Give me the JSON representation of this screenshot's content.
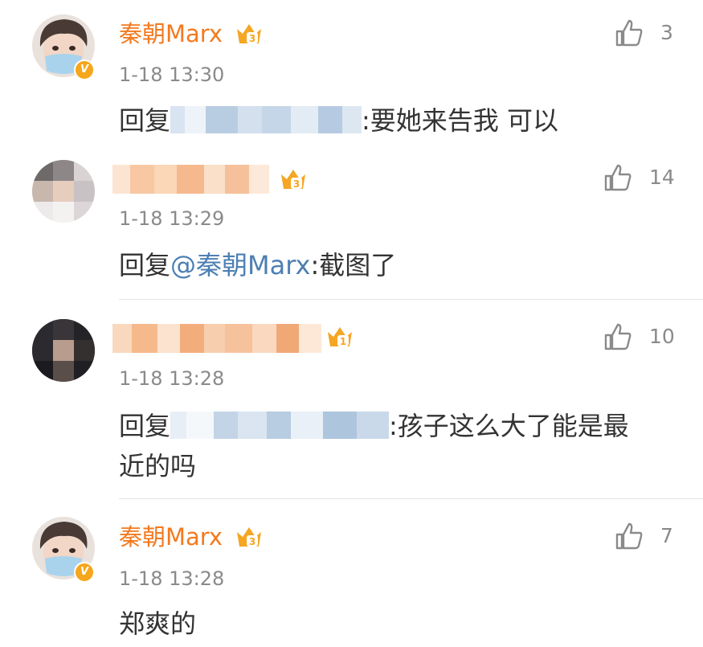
{
  "comments": [
    {
      "username": "秦朝Marx",
      "name_blurred": false,
      "level": "3",
      "time": "1-18 13:30",
      "likes": "3",
      "reply_prefix": "回复",
      "mention_blurred": true,
      "mention": "",
      "body": ":要她来告我 可以",
      "body_line2": "",
      "avatar": "avatar-masked-boy",
      "verified": true
    },
    {
      "username": "",
      "name_blurred": true,
      "level": "3",
      "time": "1-18 13:29",
      "likes": "14",
      "reply_prefix": "回复",
      "mention_blurred": false,
      "mention": "@秦朝Marx",
      "body": ":截图了",
      "body_line2": "",
      "avatar": "avatar-pixelated-girl",
      "verified": false
    },
    {
      "username": "",
      "name_blurred": true,
      "level": "1",
      "time": "1-18 13:28",
      "likes": "10",
      "reply_prefix": "回复",
      "mention_blurred": true,
      "mention": "",
      "body": ":孩子这么大了能是最",
      "body_line2": "近的吗",
      "avatar": "avatar-pixelated-dark",
      "verified": false
    },
    {
      "username": "秦朝Marx",
      "name_blurred": false,
      "level": "3",
      "time": "1-18 13:28",
      "likes": "7",
      "reply_prefix": "",
      "mention_blurred": false,
      "mention": "",
      "body": "郑爽的",
      "body_line2": "",
      "avatar": "avatar-masked-boy",
      "verified": true
    }
  ],
  "colors": {
    "username": "#f37a1f",
    "mention": "#4d7fb3",
    "meta": "#8a8a8a",
    "text": "#333333",
    "verified_badge": "#f6a61a",
    "crown": "#f5a623"
  },
  "icons": {
    "like": "thumbs-up-icon",
    "crown": "vip-crown-icon",
    "verified": "verified-v-icon"
  },
  "verified_mark": "V"
}
